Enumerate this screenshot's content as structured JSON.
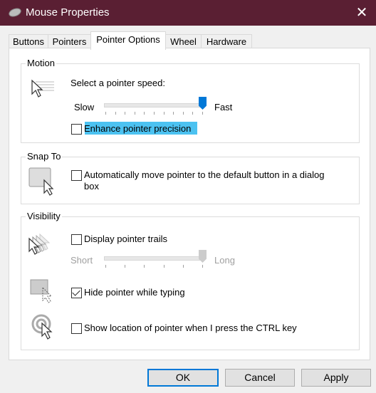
{
  "window": {
    "title": "Mouse Properties",
    "app_icon": "mouse-icon",
    "close_icon": "close-icon",
    "close_glyph": "✕"
  },
  "tabs": [
    {
      "label": "Buttons",
      "active": false
    },
    {
      "label": "Pointers",
      "active": false
    },
    {
      "label": "Pointer Options",
      "active": true
    },
    {
      "label": "Wheel",
      "active": false
    },
    {
      "label": "Hardware",
      "active": false
    }
  ],
  "motion": {
    "group_label": "Motion",
    "icon": "pointer-speed-icon",
    "speed_label": "Select a pointer speed:",
    "slow_label": "Slow",
    "fast_label": "Fast",
    "speed_slider": {
      "ticks": 11,
      "value_fraction": 1.0
    },
    "enhance_precision": {
      "label": "Enhance pointer precision",
      "checked": false,
      "focused": true
    }
  },
  "snap_to": {
    "group_label": "Snap To",
    "icon": "snap-to-button-icon",
    "auto_move": {
      "label_line1": "Automatically move pointer to the default button in a dialog",
      "label_line2": "box",
      "checked": false
    }
  },
  "visibility": {
    "group_label": "Visibility",
    "trails": {
      "icon": "pointer-trails-icon",
      "label": "Display pointer trails",
      "checked": false
    },
    "trail_length": {
      "short_label": "Short",
      "long_label": "Long",
      "ticks": 6,
      "value_fraction": 1.0,
      "enabled": false
    },
    "hide_while_typing": {
      "icon": "hide-pointer-icon",
      "label": "Hide pointer while typing",
      "checked": true
    },
    "show_location": {
      "icon": "pointer-location-icon",
      "label": "Show location of pointer when I press the CTRL key",
      "checked": false
    }
  },
  "buttons": {
    "ok": "OK",
    "cancel": "Cancel",
    "apply": "Apply"
  },
  "colors": {
    "titlebar": "#5a1f33",
    "accent": "#0078d7",
    "focus_highlight": "#4cc2f1"
  }
}
